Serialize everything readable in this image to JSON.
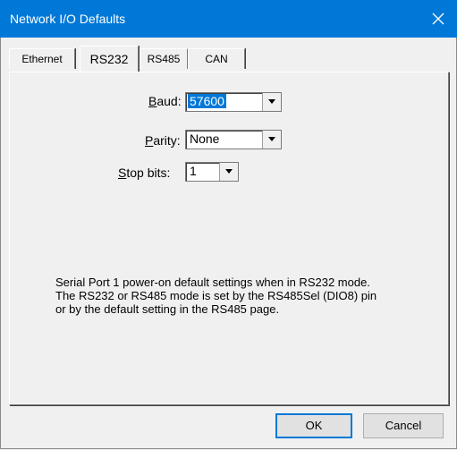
{
  "window": {
    "title": "Network I/O Defaults",
    "close_glyph": "✕"
  },
  "tabs": [
    {
      "label": "Ethernet",
      "active": false
    },
    {
      "label": "RS232",
      "active": true
    },
    {
      "label": "RS485",
      "active": false
    },
    {
      "label": "CAN",
      "active": false
    }
  ],
  "fields": {
    "baud": {
      "label_mnemonic": "B",
      "label_rest": "aud:",
      "value": "57600"
    },
    "parity": {
      "label_mnemonic": "P",
      "label_rest": "arity:",
      "value": "None"
    },
    "stop_bits": {
      "label_mnemonic": "S",
      "label_rest": "top bits:",
      "value": "1"
    }
  },
  "description": {
    "lines": [
      "Serial Port 1 power-on default settings when in RS232 mode.",
      "The RS232 or RS485 mode is set by the RS485Sel (DIO8) pin",
      "or by the default setting in the RS485 page."
    ]
  },
  "buttons": {
    "ok": "OK",
    "cancel": "Cancel"
  },
  "colors": {
    "title_bar": "#0078d7",
    "selection": "#0078d7",
    "dialog_bg": "#f0f0f0"
  },
  "icons": {
    "close": "close-icon",
    "dropdown": "chevron-down-icon"
  }
}
